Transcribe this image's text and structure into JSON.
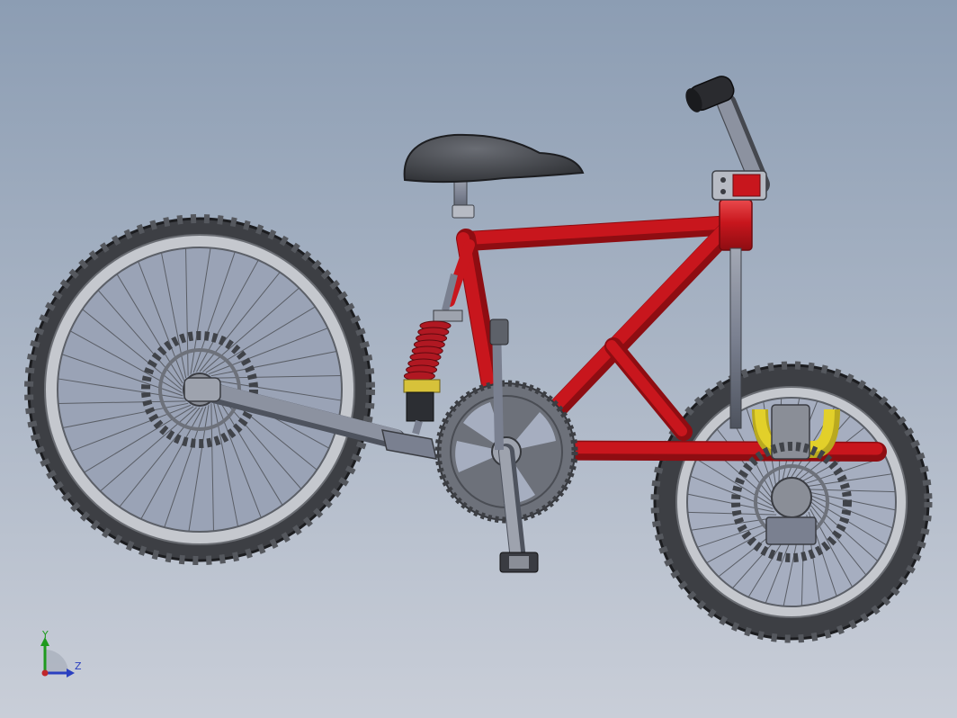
{
  "viewport": {
    "background_top": "#8c9db3",
    "background_bottom": "#c9ced8"
  },
  "model": {
    "frame_color": "#c8161d",
    "frame_highlight": "#e9494c",
    "frame_shadow": "#8e0d12",
    "metal_color": "#7a8090",
    "tire_color": "#3d3f44",
    "rim_color": "#b9bcc3",
    "saddle_color": "#3e4045",
    "spring_color": "#b01822",
    "yoke_color": "#e2d02a"
  },
  "triad": {
    "y_label": "Y",
    "z_label": "Z",
    "y_color": "#1e9a1e",
    "z_color": "#2a3fc0",
    "x_color": "#c0262a"
  }
}
